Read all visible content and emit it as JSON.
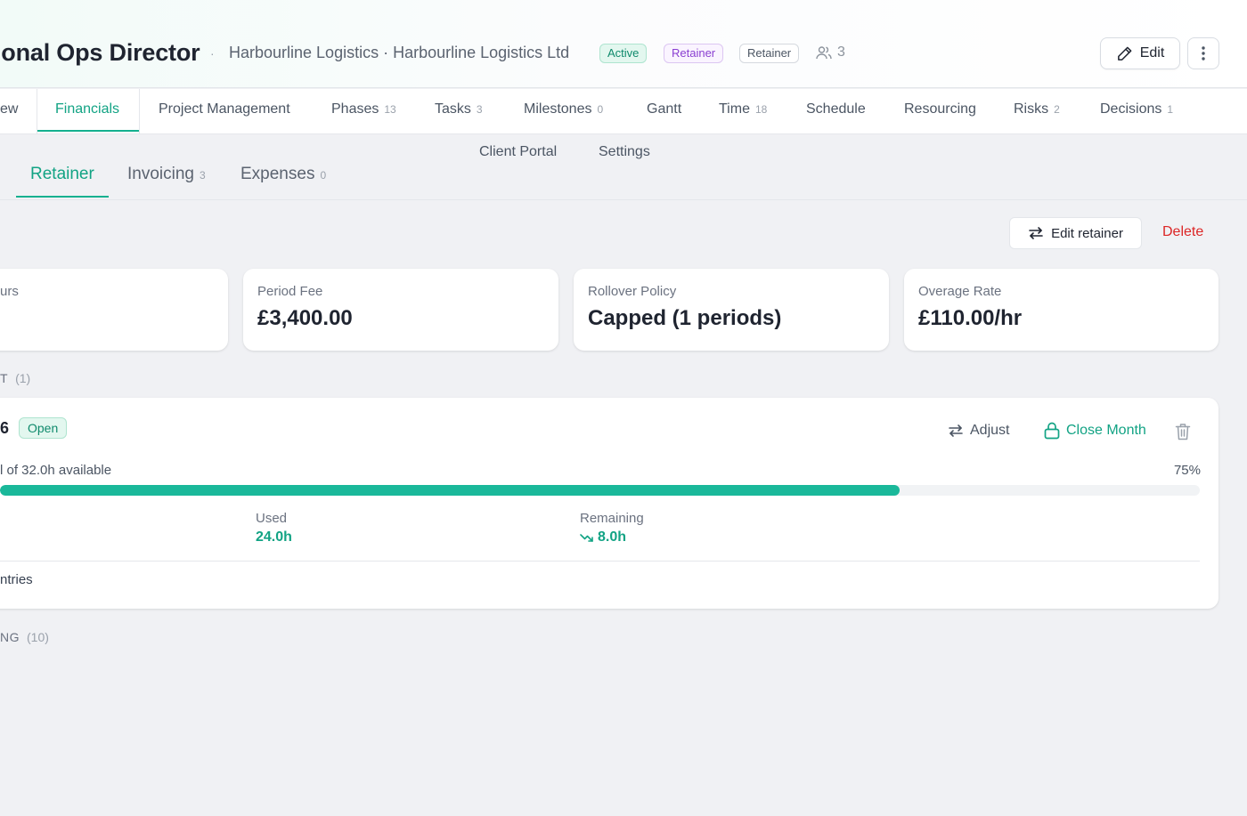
{
  "header": {
    "title": "ional Ops Director",
    "separator": "·",
    "client": "Harbourline Logistics · Harbourline Logistics Ltd",
    "badges": {
      "status": "Active",
      "type": "Retainer",
      "billing": "Retainer"
    },
    "members_count": "3",
    "edit_label": "Edit"
  },
  "tabs": [
    {
      "label": "ew",
      "count": ""
    },
    {
      "label": "Financials",
      "count": ""
    },
    {
      "label": "Project Management",
      "count": ""
    },
    {
      "label": "Phases",
      "count": "13"
    },
    {
      "label": "Tasks",
      "count": "3"
    },
    {
      "label": "Milestones",
      "count": "0"
    },
    {
      "label": "Gantt",
      "count": ""
    },
    {
      "label": "Time",
      "count": "18"
    },
    {
      "label": "Schedule",
      "count": ""
    },
    {
      "label": "Resourcing",
      "count": ""
    },
    {
      "label": "Risks",
      "count": "2"
    },
    {
      "label": "Decisions",
      "count": "1"
    },
    {
      "label": "Client Portal",
      "count": ""
    },
    {
      "label": "Settings",
      "count": ""
    }
  ],
  "subtabs": [
    {
      "label": "Retainer",
      "count": ""
    },
    {
      "label": "Invoicing",
      "count": "3"
    },
    {
      "label": "Expenses",
      "count": "0"
    }
  ],
  "actions": {
    "edit_retainer": "Edit retainer",
    "delete": "Delete"
  },
  "stats": [
    {
      "label": "urs",
      "value": ""
    },
    {
      "label": "Period Fee",
      "value": "£3,400.00"
    },
    {
      "label": "Rollover Policy",
      "value": "Capped (1 periods)"
    },
    {
      "label": "Overage Rate",
      "value": "£110.00/hr"
    }
  ],
  "current_section": {
    "title": "T",
    "count": "(1)"
  },
  "period": {
    "name": "6",
    "status": "Open",
    "adjust_label": "Adjust",
    "close_label": "Close Month",
    "available_text": "l of 32.0h available",
    "percent_label": "75%",
    "progress_fraction": 0.75,
    "used_label": "Used",
    "used_value": "24.0h",
    "remaining_label": "Remaining",
    "remaining_value": "8.0h",
    "entries_label": "ntries"
  },
  "history_section": {
    "title": "NG",
    "count": "(10)"
  },
  "colors": {
    "accent": "#14b08f",
    "danger": "#dc2626",
    "retainer_badge": "#8a3fd1"
  }
}
